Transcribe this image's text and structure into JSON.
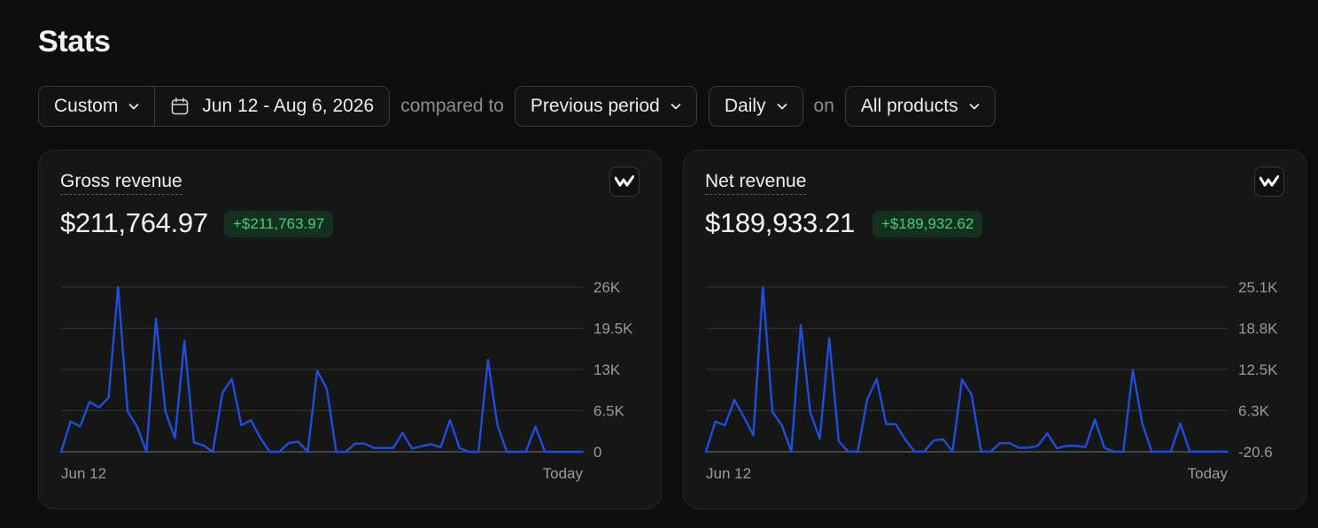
{
  "page": {
    "title": "Stats"
  },
  "filters": {
    "range_preset": "Custom",
    "date_range": "Jun 12 - Aug 6, 2026",
    "compared_to_text": "compared to",
    "comparison": "Previous period",
    "interval": "Daily",
    "on_text": "on",
    "products": "All products"
  },
  "colors": {
    "accent": "#1e4fdc",
    "positive": "#3fd07a",
    "positive_bg": "#14301f"
  },
  "icons": {
    "calendar": "calendar-icon",
    "chevron": "chevron-down-icon",
    "brand": "brand-logo-icon"
  },
  "cards": [
    {
      "label": "Gross revenue",
      "value": "$211,764.97",
      "change": "+$211,763.97"
    },
    {
      "label": "Net revenue",
      "value": "$189,933.21",
      "change": "+$189,932.62"
    }
  ],
  "chart_data": [
    {
      "type": "line",
      "x_start_label": "Jun 12",
      "x_end_label": "Today",
      "y_ticks": [
        "26K",
        "19.5K",
        "13K",
        "6.5K",
        "0"
      ],
      "ylim": [
        0,
        26000
      ],
      "grid": true,
      "values": [
        0,
        4800,
        4000,
        7900,
        7000,
        8500,
        26000,
        6400,
        4000,
        0,
        21000,
        6300,
        2200,
        17500,
        1500,
        1000,
        0,
        9300,
        11500,
        4200,
        5000,
        2200,
        0,
        0,
        1400,
        1600,
        0,
        12800,
        10000,
        0,
        0,
        1300,
        1300,
        600,
        600,
        600,
        3000,
        500,
        900,
        1200,
        700,
        5000,
        600,
        0,
        0,
        14500,
        4200,
        0,
        0,
        0,
        4000,
        0,
        0,
        0,
        0,
        0
      ]
    },
    {
      "type": "line",
      "x_start_label": "Jun 12",
      "x_end_label": "Today",
      "y_ticks": [
        "25.1K",
        "18.8K",
        "12.5K",
        "6.3K",
        "-20.6"
      ],
      "ylim": [
        -20.6,
        25100
      ],
      "grid": true,
      "values": [
        0,
        4600,
        4000,
        7900,
        5300,
        2500,
        25100,
        6100,
        4000,
        0,
        19300,
        6000,
        2000,
        17300,
        1600,
        0,
        0,
        8000,
        11100,
        4200,
        4200,
        1900,
        0,
        0,
        1700,
        1900,
        0,
        11000,
        8700,
        0,
        0,
        1300,
        1300,
        600,
        600,
        900,
        2800,
        500,
        900,
        900,
        700,
        4900,
        600,
        0,
        0,
        12400,
        4300,
        0,
        0,
        0,
        4300,
        0,
        0,
        0,
        0,
        0
      ]
    }
  ]
}
